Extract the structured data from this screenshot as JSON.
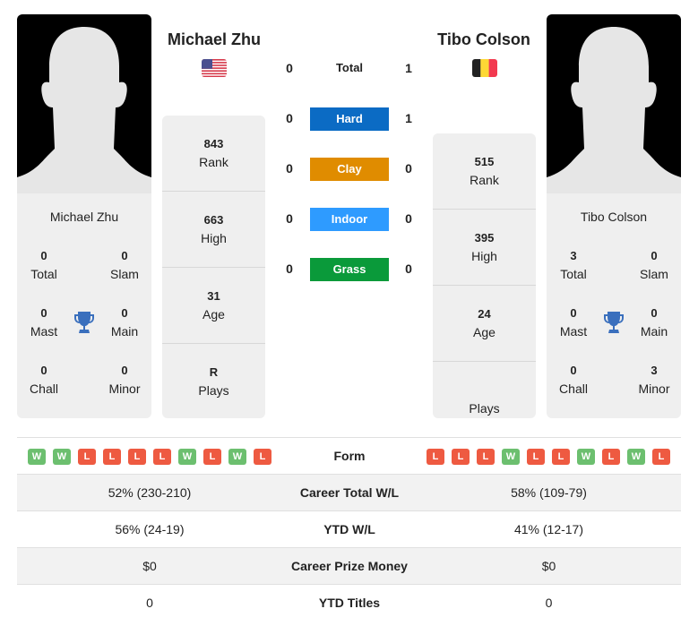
{
  "colors": {
    "hard": "#0b6bc4",
    "clay": "#e08c00",
    "indoor": "#2e9bff",
    "grass": "#0a9a3a",
    "win": "#6cbf6f",
    "loss": "#ee5a41",
    "trophy": "#3a6fbd"
  },
  "player1": {
    "name": "Michael Zhu",
    "flag": "USA",
    "card_name": "Michael Zhu",
    "titles": {
      "total": {
        "value": "0",
        "label": "Total"
      },
      "slam": {
        "value": "0",
        "label": "Slam"
      },
      "mast": {
        "value": "0",
        "label": "Mast"
      },
      "main": {
        "value": "0",
        "label": "Main"
      },
      "chall": {
        "value": "0",
        "label": "Chall"
      },
      "minor": {
        "value": "0",
        "label": "Minor"
      }
    },
    "stats": {
      "rank": {
        "value": "843",
        "label": "Rank"
      },
      "high": {
        "value": "663",
        "label": "High"
      },
      "age": {
        "value": "31",
        "label": "Age"
      },
      "plays": {
        "value": "R",
        "label": "Plays"
      }
    },
    "form": [
      "W",
      "W",
      "L",
      "L",
      "L",
      "L",
      "W",
      "L",
      "W",
      "L"
    ]
  },
  "player2": {
    "name": "Tibo Colson",
    "flag": "Belgium",
    "card_name": "Tibo Colson",
    "titles": {
      "total": {
        "value": "3",
        "label": "Total"
      },
      "slam": {
        "value": "0",
        "label": "Slam"
      },
      "mast": {
        "value": "0",
        "label": "Mast"
      },
      "main": {
        "value": "0",
        "label": "Main"
      },
      "chall": {
        "value": "0",
        "label": "Chall"
      },
      "minor": {
        "value": "3",
        "label": "Minor"
      }
    },
    "stats": {
      "rank": {
        "value": "515",
        "label": "Rank"
      },
      "high": {
        "value": "395",
        "label": "High"
      },
      "age": {
        "value": "24",
        "label": "Age"
      },
      "plays": {
        "value": "",
        "label": "Plays"
      }
    },
    "form": [
      "L",
      "L",
      "L",
      "W",
      "L",
      "L",
      "W",
      "L",
      "W",
      "L"
    ]
  },
  "h2h": {
    "total": {
      "label": "Total",
      "p1": "0",
      "p2": "1"
    },
    "hard": {
      "label": "Hard",
      "p1": "0",
      "p2": "1"
    },
    "clay": {
      "label": "Clay",
      "p1": "0",
      "p2": "0"
    },
    "indoor": {
      "label": "Indoor",
      "p1": "0",
      "p2": "0"
    },
    "grass": {
      "label": "Grass",
      "p1": "0",
      "p2": "0"
    }
  },
  "comparison": {
    "form_label": "Form",
    "rows": [
      {
        "label": "Career Total W/L",
        "p1": "52% (230-210)",
        "p2": "58% (109-79)"
      },
      {
        "label": "YTD W/L",
        "p1": "56% (24-19)",
        "p2": "41% (12-17)"
      },
      {
        "label": "Career Prize Money",
        "p1": "$0",
        "p2": "$0"
      },
      {
        "label": "YTD Titles",
        "p1": "0",
        "p2": "0"
      }
    ]
  }
}
